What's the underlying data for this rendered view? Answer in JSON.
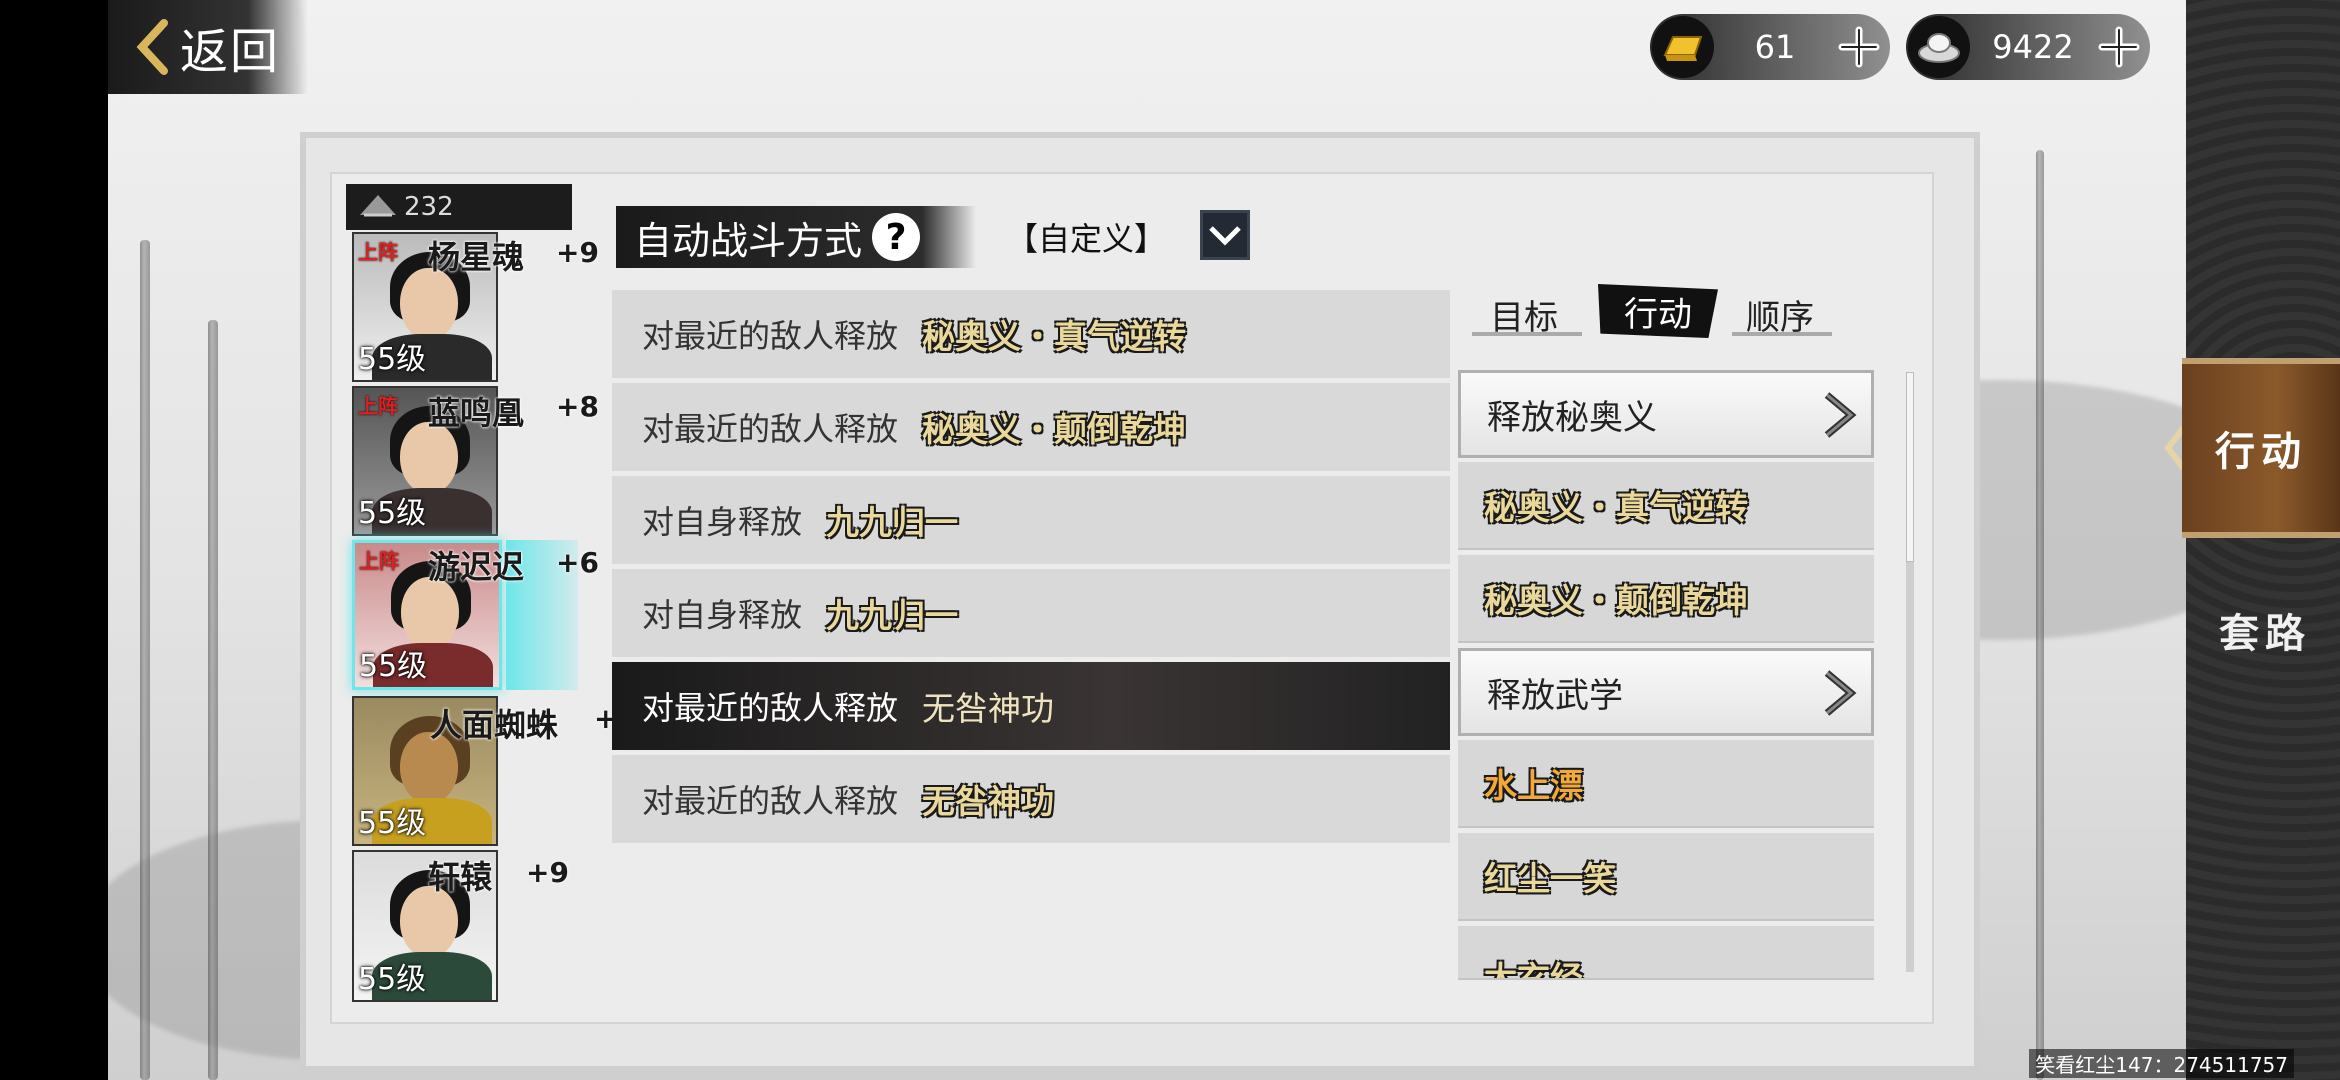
{
  "topbar": {
    "back_label": "返回"
  },
  "currency": [
    {
      "name": "gold-ingot",
      "value": "61"
    },
    {
      "name": "silver-ingot",
      "value": "9422"
    }
  ],
  "roster": {
    "count": "232",
    "heroes": [
      {
        "tag": "上阵",
        "name": "杨星魂",
        "plus": "+9",
        "level": "55级"
      },
      {
        "tag": "上阵",
        "name": "蓝鸣凰",
        "plus": "+8",
        "level": "55级"
      },
      {
        "tag": "上阵",
        "name": "游迟迟",
        "plus": "+6",
        "level": "55级"
      },
      {
        "tag": "",
        "name": "人面蜘蛛",
        "plus": "+",
        "level": "55级"
      },
      {
        "tag": "",
        "name": "轩辕",
        "plus": "+9",
        "level": "55级"
      }
    ]
  },
  "auto_battle": {
    "title": "自动战斗方式",
    "help": "?",
    "mode_label": "【自定义】"
  },
  "rules": [
    {
      "condition": "对最近的敌人释放",
      "skill": "秘奥义・真气逆转"
    },
    {
      "condition": "对最近的敌人释放",
      "skill": "秘奥义・颠倒乾坤"
    },
    {
      "condition": "对自身释放",
      "skill": "九九归一"
    },
    {
      "condition": "对自身释放",
      "skill": "九九归一"
    },
    {
      "condition": "对最近的敌人释放",
      "skill": "无咎神功"
    },
    {
      "condition": "对最近的敌人释放",
      "skill": "无咎神功"
    }
  ],
  "subtabs": {
    "target": "目标",
    "action": "行动",
    "order": "顺序"
  },
  "action_list": {
    "section1": "释放秘奥义",
    "section1_items": [
      "秘奥义・真气逆转",
      "秘奥义・颠倒乾坤"
    ],
    "section2": "释放武学",
    "section2_items": [
      "水上漂",
      "红尘一笑",
      "太玄经"
    ]
  },
  "side_tabs": {
    "active": "行动",
    "inactive": "套路"
  },
  "watermark": "笑看红尘147：274511757",
  "colors": {
    "skill_gold": "#e9d79b",
    "skill_orange": "#f2a93a",
    "selected_border": "#6ee6ea",
    "side_tab_brown": "#8b5a2b"
  }
}
